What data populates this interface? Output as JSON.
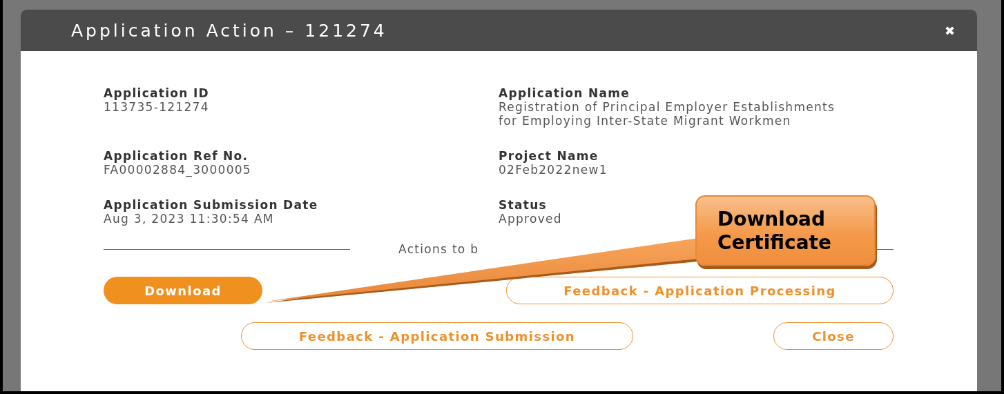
{
  "dialog": {
    "title": "Application Action – 121274",
    "close": "✖"
  },
  "fields": [
    {
      "label": "Application ID",
      "value": "113735-121274"
    },
    {
      "label": "Application Name",
      "value": "Registration of Principal Employer Establishments for Employing Inter-State Migrant Workmen"
    },
    {
      "label": "Application Ref No.",
      "value": "FA00002884_3000005"
    },
    {
      "label": "Project Name",
      "value": "02Feb2022new1"
    },
    {
      "label": "Application Submission Date",
      "value": "Aug 3, 2023 11:30:54 AM"
    },
    {
      "label": "Status",
      "value": "Approved"
    }
  ],
  "divider_label": "Actions to b",
  "button_rows": [
    [
      {
        "label": "Download",
        "kind": "filled"
      },
      {
        "label": "Feedback - Application Processing",
        "kind": "outline"
      }
    ],
    [
      {
        "label": "Feedback - Application Submission",
        "kind": "outline"
      },
      {
        "label": "Close",
        "kind": "outline"
      }
    ]
  ],
  "callout": {
    "text": "Download Certificate"
  }
}
